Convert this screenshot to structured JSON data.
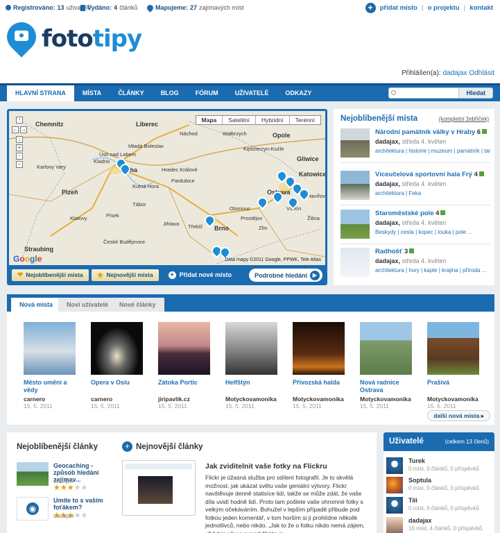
{
  "topbar": {
    "registered_label": "Registrováno:",
    "registered_value": "13",
    "registered_unit": "uživatelů",
    "published_label": "Vydáno:",
    "published_value": "4",
    "published_unit": "článků",
    "mapping_label": "Mapujeme:",
    "mapping_value": "27",
    "mapping_unit": "zajímavých míst",
    "add_place": "přidat místo",
    "about": "o projektu",
    "contact": "kontakt"
  },
  "logo": {
    "part1": "foto",
    "part2": "tipy"
  },
  "login": {
    "prefix": "Přihlášen(a):",
    "user": "dadajax",
    "logout": "Odhlásit"
  },
  "nav": {
    "items": [
      "HLAVNÍ STRANA",
      "MÍSTA",
      "ČLÁNKY",
      "BLOG",
      "FÓRUM",
      "UŽIVATELÉ",
      "ODKAZY"
    ],
    "search_placeholder": "",
    "search_button": "Hledat"
  },
  "map": {
    "types": [
      "Mapa",
      "Satelitní",
      "Hybridní",
      "Terénní"
    ],
    "labels": [
      "Chemnitz",
      "Liberec",
      "Náchod",
      "Wałbrzych",
      "Opole",
      "Kędzierzyn-Koźle",
      "Gliwice",
      "Katowice",
      "Kladno",
      "Praha",
      "Hradec Králové",
      "Pardubice",
      "Plzeň",
      "Kutná Hora",
      "Olomouc",
      "Ostrava",
      "Havířov",
      "Jihlava",
      "Brno",
      "Zlín",
      "Žilina",
      "České Budějovice",
      "Straubing",
      "Ústí nad Labem",
      "Vsetín",
      "Prostějov",
      "Třebíč",
      "Klatovy",
      "Písek",
      "Tábor",
      "Karlovy Vary",
      "Mladá Boleslav"
    ],
    "copyright": "Data mapy ©2011 Google, PPWK, Tele Atlas",
    "google": "Google"
  },
  "mapbar": {
    "favorite": "Nejoblíbenější místa",
    "newest": "Nejnovější místa",
    "add": "Přidat nové místo",
    "advanced": "Podrobné hledání"
  },
  "favplaces": {
    "title": "Nejoblíbenější místa",
    "chart_link": "(kompletní žebříček)",
    "items": [
      {
        "name": "Národní památník války v Hraby",
        "count": "6",
        "user": "dadajax,",
        "date": "středa 4. květen",
        "tags": "architektura | historie | muzeum | památník | tank"
      },
      {
        "name": "Víceučelová sportovní hala Frý",
        "count": "4",
        "user": "dadajax,",
        "date": "středa 4. květen",
        "tags": "architektura | Feka"
      },
      {
        "name": "Staroměstské pole",
        "count": "4",
        "user": "dadajax,",
        "date": "středa 4. květen",
        "tags": "Beskydy | cesta | kopec | louka | pole ..."
      },
      {
        "name": "Radhošť",
        "count": "3",
        "user": "dadajax,",
        "date": "středa 4. květen",
        "tags": "architektura | hory | kaple | krajina | příroda ..."
      }
    ]
  },
  "newplaces": {
    "tabs": [
      "Nová místa",
      "Noví uživatelé",
      "Nové články"
    ],
    "items": [
      {
        "name": "Město umění a vědy",
        "user": "carnero",
        "date": "15. 5. 2011"
      },
      {
        "name": "Opera v Oslu",
        "user": "carnero",
        "date": "15. 5. 2011"
      },
      {
        "name": "Zátoka Portic",
        "user": "jiripavlik.cz",
        "date": "15. 5. 2011"
      },
      {
        "name": "Helfštýn",
        "user": "Motyckovamonika",
        "date": "15. 5. 2011"
      },
      {
        "name": "Přívozská halda",
        "user": "Motyckovamonika",
        "date": "15. 5. 2011"
      },
      {
        "name": "Nová radnice Ostrava",
        "user": "Motyckovamonika",
        "date": "15. 5. 2011"
      },
      {
        "name": "Prašivá",
        "user": "Motyckovamonika",
        "date": "15. 5. 2011"
      }
    ],
    "more": "další nová místa"
  },
  "articles": {
    "fav_title": "Nejoblíbenější články",
    "new_title": "Nejnovější články",
    "fav_items": [
      {
        "title": "Geocaching - způsob hledání zajímav...",
        "user": "dadajax",
        "rating": 3
      },
      {
        "title": "Umíte to s vaším foťákem?",
        "user": "dadajax",
        "rating": 3
      }
    ],
    "new_article_title": "Jak zviditelnit vaše fotky na Flickru",
    "new_article_text": "Flickr je úžasná služba pro sdílení fotografií. Je to skvělá možnost, jak ukázat světu vaše geniální výtvory. Flickr navštěvuje denně statisíce lidí, takže se může zdát, že vaše díla uvidí hodně lidí. Proto tam pošlete vaše ohromné fotky s velkým očekáváním. Bohužel v lepším případě přibude pod fotkou jeden komentář, v tom horším si ji prohlídne několik jednotlivců, nebo nikdo. „Jak to že o fotku nikdo nemá zájem, vždyť je přece super“ říkáte si."
  },
  "users": {
    "title": "Uživatelé",
    "count": "(celkem 13 členů)",
    "items": [
      {
        "name": "Turek",
        "meta": "0 míst, 0 článků, 0 příspěvků"
      },
      {
        "name": "Soptula",
        "meta": "0 míst, 0 článků, 0 příspěvků"
      },
      {
        "name": "Tiii",
        "meta": "0 míst, 0 článků, 0 příspěvků"
      },
      {
        "name": "dadajax",
        "meta": "16 míst, 4 článků, 0 příspěvků"
      }
    ]
  }
}
